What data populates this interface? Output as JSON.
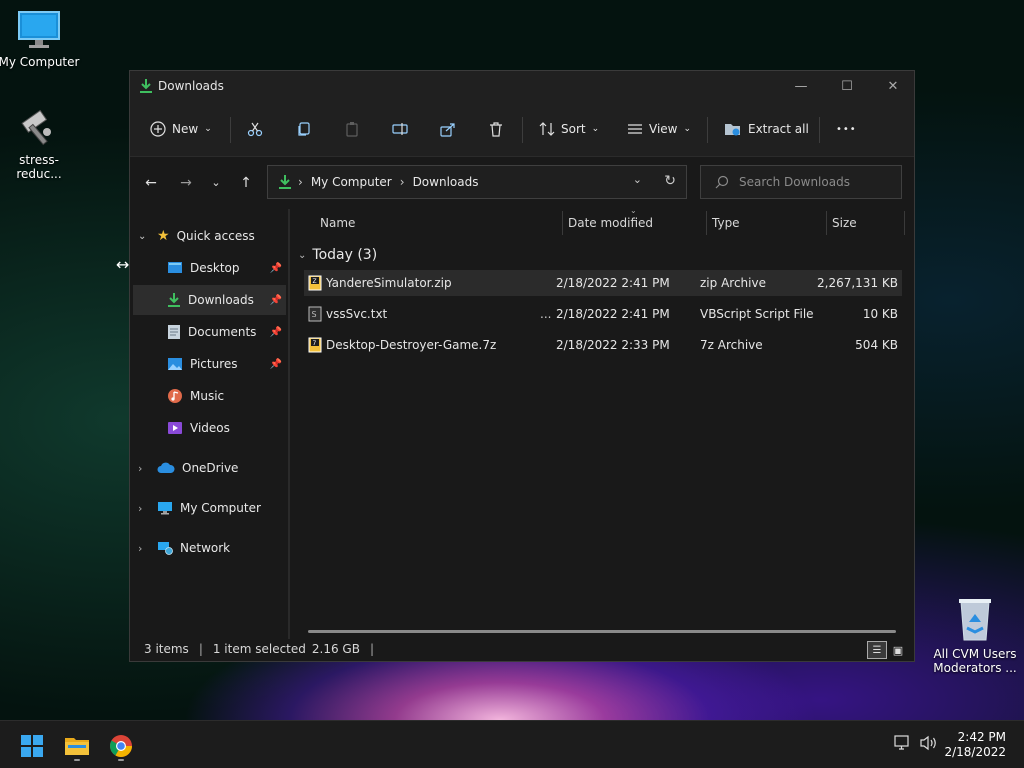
{
  "desktop": {
    "icons": [
      {
        "label": "My Computer"
      },
      {
        "label": "stress-reduc..."
      },
      {
        "label": "All CVM Users Moderators ..."
      }
    ]
  },
  "window": {
    "title": "Downloads",
    "toolbar": {
      "new_label": "New",
      "sort_label": "Sort",
      "view_label": "View",
      "extract_label": "Extract all",
      "more_label": "•••"
    },
    "address": {
      "crumbs": [
        "My Computer",
        "Downloads"
      ]
    },
    "search": {
      "placeholder": "Search Downloads"
    },
    "nav": {
      "quick_access": "Quick access",
      "items": [
        {
          "label": "Desktop"
        },
        {
          "label": "Downloads"
        },
        {
          "label": "Documents"
        },
        {
          "label": "Pictures"
        },
        {
          "label": "Music"
        },
        {
          "label": "Videos"
        }
      ],
      "onedrive": "OneDrive",
      "my_computer": "My Computer",
      "network": "Network"
    },
    "columns": {
      "name": "Name",
      "date": "Date modified",
      "type": "Type",
      "size": "Size"
    },
    "group": "Today (3)",
    "files": [
      {
        "name": "YandereSimulator.zip",
        "date": "2/18/2022 2:41 PM",
        "type": "zip Archive",
        "size": "2,267,131 KB"
      },
      {
        "name": "vssSvc.txt",
        "ellipsis": "...",
        "date": "2/18/2022 2:41 PM",
        "type": "VBScript Script File",
        "size": "10 KB"
      },
      {
        "name": "Desktop-Destroyer-Game.7z",
        "date": "2/18/2022 2:33 PM",
        "type": "7z Archive",
        "size": "504 KB"
      }
    ],
    "status": {
      "items": "3 items",
      "selected": "1 item selected",
      "size": "2.16 GB"
    }
  },
  "taskbar": {
    "time": "2:42 PM",
    "date": "2/18/2022"
  },
  "colors": {
    "accent_green": "#3fbf5f",
    "folder_yellow": "#f3c13a",
    "window_bg": "#191919"
  }
}
